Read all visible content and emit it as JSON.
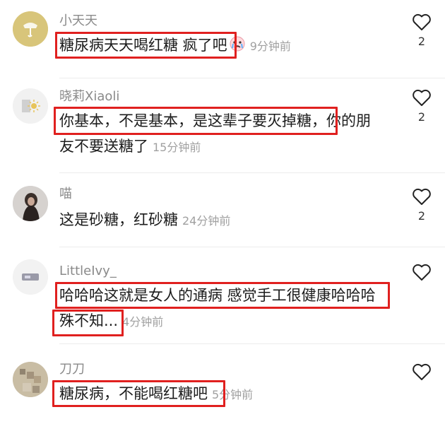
{
  "comments": [
    {
      "username": "小天天",
      "lines": [
        "糖尿病天天喝红糖 疯了吧"
      ],
      "emoji": "crying-face-emoji",
      "time": "9分钟前",
      "likes": "2"
    },
    {
      "username": "晓莉Xiaoli",
      "lines": [
        "你基本，不是基本，是这辈子要灭掉糖，你的朋",
        "友不要送糖了"
      ],
      "time": "15分钟前",
      "likes": "2"
    },
    {
      "username": "喵",
      "lines": [
        "这是砂糖，红砂糖"
      ],
      "time": "24分钟前",
      "likes": "2"
    },
    {
      "username": "LittleIvy_",
      "lines": [
        "哈哈哈这就是女人的通病 感觉手工很健康哈哈哈",
        "殊不知..."
      ],
      "time": "4分钟前",
      "likes": ""
    },
    {
      "username": "刀刀",
      "lines": [
        "糖尿病，不能喝红糖吧"
      ],
      "time": "5分钟前",
      "likes": ""
    }
  ],
  "colors": {
    "highlight": "#e0201f",
    "username": "#8a8a8a",
    "time": "#a0a0a0"
  }
}
